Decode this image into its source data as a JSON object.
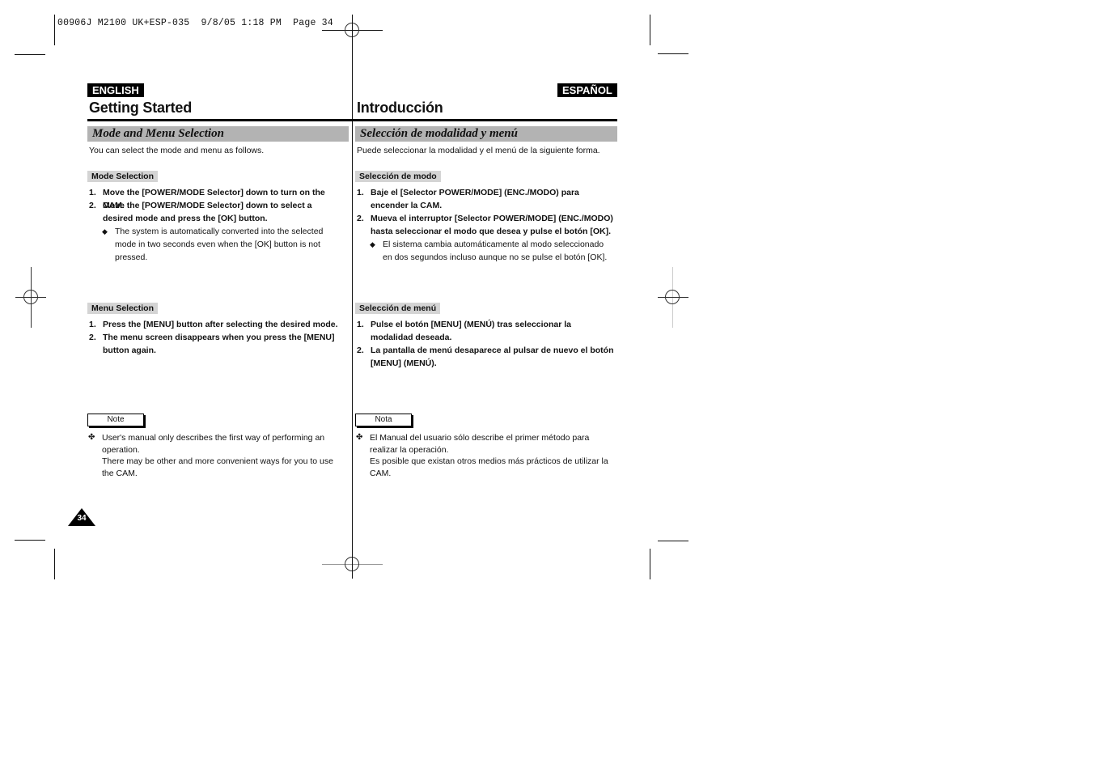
{
  "slug": "00906J M2100 UK+ESP-035  9/8/05 1:18 PM  Page 34",
  "english": {
    "lang_label": "ENGLISH",
    "title": "Getting Started",
    "section_title": "Mode and Menu Selection",
    "intro": "You can select the mode and menu as follows.",
    "mode_selection": {
      "label": "Mode Selection",
      "steps": [
        {
          "num": "1.",
          "text": "Move the [POWER/MODE Selector] down to turn on the CAM."
        },
        {
          "num": "2.",
          "text": "Move the [POWER/MODE Selector] down to select a desired mode and press the [OK] button."
        }
      ],
      "bullet": {
        "symbol": "◆",
        "text": "The system is automatically converted into the selected mode in two seconds even when the [OK] button is not pressed."
      }
    },
    "menu_selection": {
      "label": "Menu Selection",
      "steps": [
        {
          "num": "1.",
          "text": "Press the [MENU] button after selecting the desired mode."
        },
        {
          "num": "2.",
          "text": "The menu screen disappears when you press the [MENU] button again."
        }
      ]
    },
    "note": {
      "label": "Note",
      "symbol": "✤",
      "text": "User's manual only describes the first way of performing an operation.",
      "text2": "There may be other and more convenient ways for you to use the CAM."
    }
  },
  "spanish": {
    "lang_label": "ESPAÑOL",
    "title": "Introducción",
    "section_title": "Selección de modalidad y menú",
    "intro": "Puede seleccionar la modalidad y el menú de la siguiente forma.",
    "mode_selection": {
      "label": "Selección de modo",
      "steps": [
        {
          "num": "1.",
          "text": "Baje el [Selector POWER/MODE] (ENC./MODO) para encender la CAM."
        },
        {
          "num": "2.",
          "text": "Mueva el interruptor [Selector POWER/MODE] (ENC./MODO) hasta seleccionar el modo que desea y pulse el botón [OK]."
        }
      ],
      "bullet": {
        "symbol": "◆",
        "text": "El sistema cambia automáticamente al modo seleccionado en dos segundos incluso aunque no se pulse el botón [OK]."
      }
    },
    "menu_selection": {
      "label": "Selección de menú",
      "steps": [
        {
          "num": "1.",
          "text": "Pulse el botón [MENU] (MENÚ) tras seleccionar la modalidad deseada."
        },
        {
          "num": "2.",
          "text": "La pantalla de menú desaparece al pulsar de nuevo el botón [MENU] (MENÚ)."
        }
      ]
    },
    "note": {
      "label": "Nota",
      "symbol": "✤",
      "text": "El Manual del usuario sólo describe el primer método para realizar la operación.",
      "text2": "Es posible que existan otros medios más prácticos de utilizar la CAM."
    }
  },
  "page_number": "34"
}
